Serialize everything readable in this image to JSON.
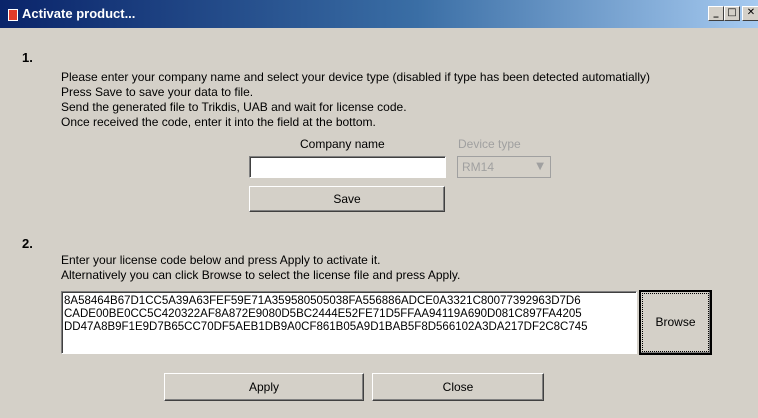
{
  "window": {
    "title": "Activate product...",
    "controls": {
      "minimize": "_",
      "maximize": "□",
      "close": "✕"
    }
  },
  "step1": {
    "number": "1.",
    "instructions": [
      "Please enter your company name and select your device type (disabled if type has been detected automatially)",
      "Press Save to save your data to file.",
      "Send the generated file to Trikdis, UAB and wait for license code.",
      "Once received the code, enter it into the field at the bottom."
    ],
    "company_label": "Company name",
    "company_value": "",
    "device_label": "Device type",
    "device_value": "RM14",
    "save_label": "Save"
  },
  "step2": {
    "number": "2.",
    "instructions": [
      "Enter your license code below and press Apply to activate it.",
      "Alternatively you can click Browse to select the license file and press Apply."
    ],
    "license_code": "8A58464B67D1CC5A39A63FEF59E71A359580505038FA556886ADCE0A3321C80077392963D7D6\nCADE00BE0CC5C420322AF8A872E9080D5BC2444E52FE71D5FFAA94119A690D081C897FA4205\nDD47A8B9F1E9D7B65CC70DF5AEB1DB9A0CF861B05A9D1BAB5F8D566102A3DA217DF2C8C745",
    "browse_label": "Browse"
  },
  "footer": {
    "apply_label": "Apply",
    "close_label": "Close"
  },
  "colors": {
    "titlebar_start": "#0a246a",
    "titlebar_end": "#a6caf0",
    "dialog_bg": "#d4d0c8"
  }
}
